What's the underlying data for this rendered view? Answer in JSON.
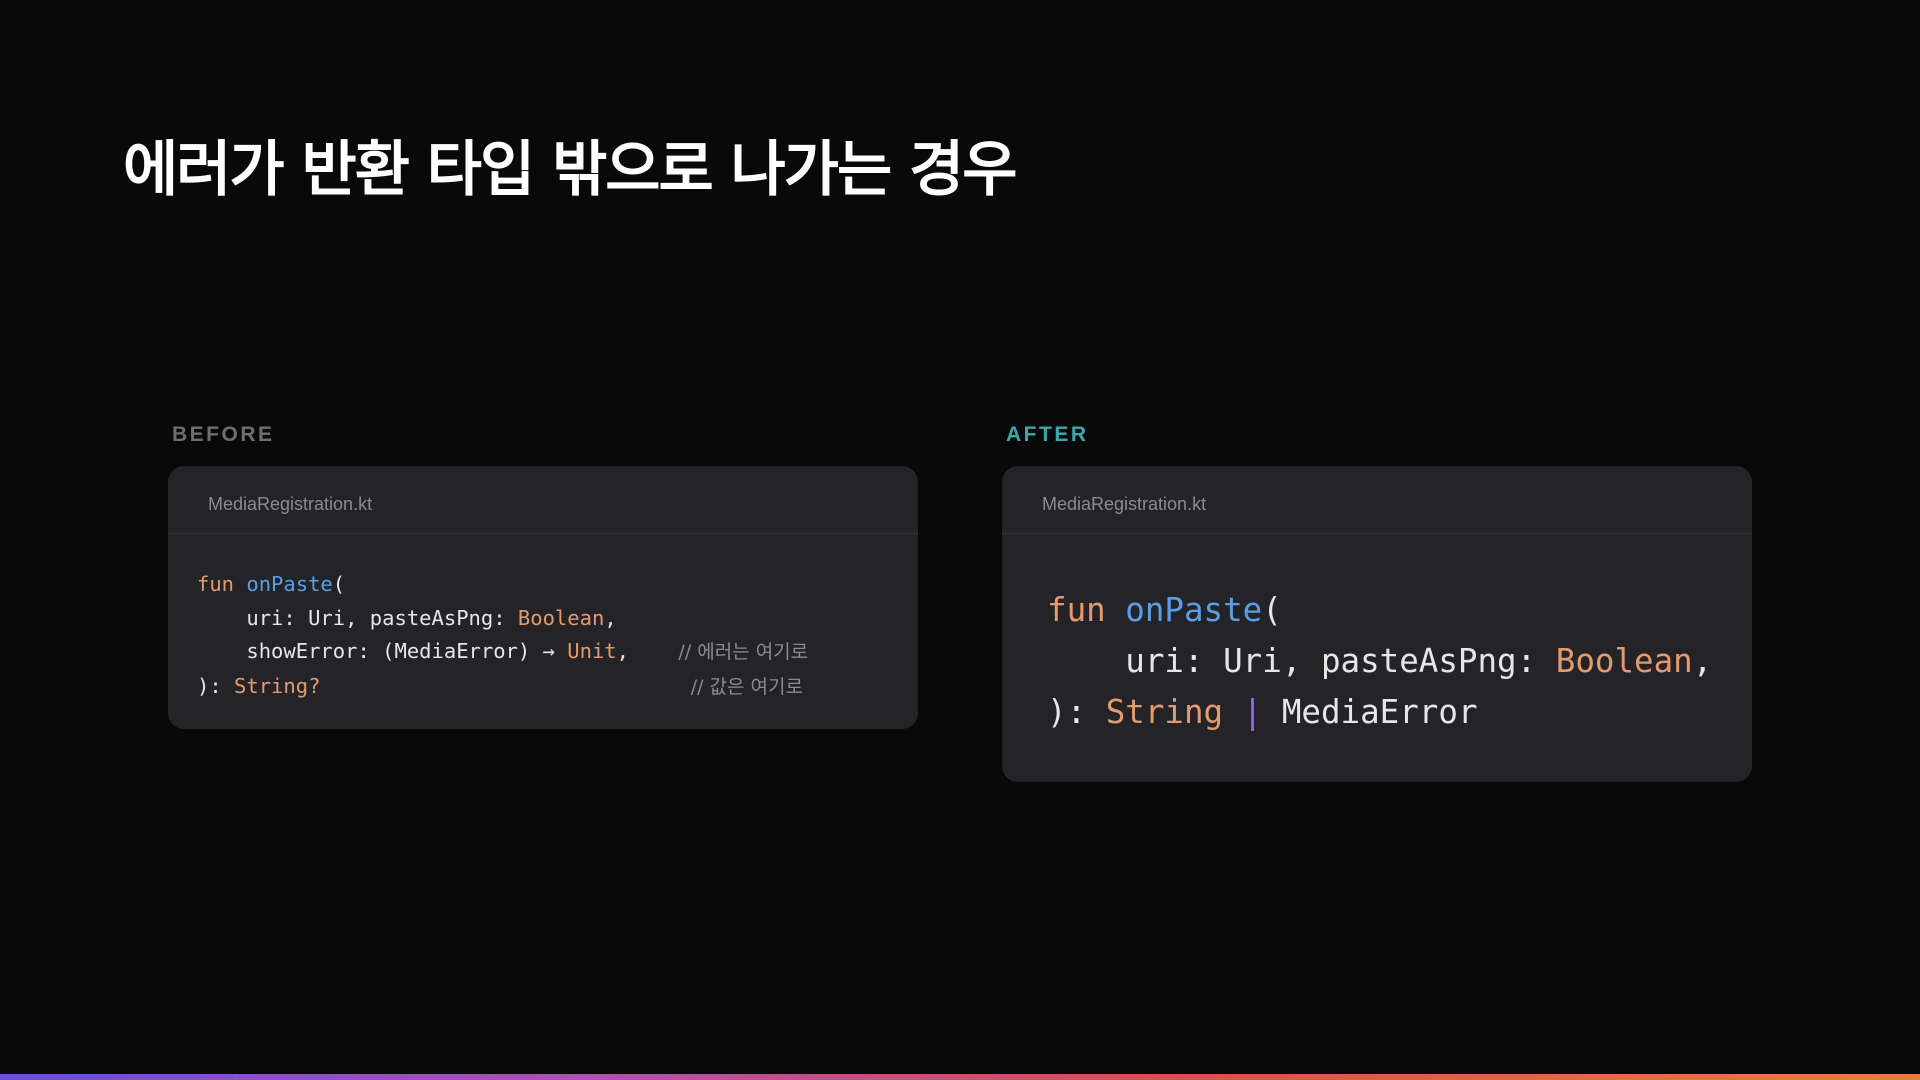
{
  "slide": {
    "title": "에러가 반환 타입 밖으로 나가는 경우"
  },
  "before": {
    "label": "BEFORE",
    "file_name": "MediaRegistration.kt",
    "lines": [
      {
        "kw": "fun",
        "fn": "onPaste",
        "punct": "("
      },
      {
        "indent": "    ",
        "text": "uri: Uri, pasteAsPng: ",
        "type": "Boolean",
        "tail": ","
      },
      {
        "indent": "    ",
        "text": "showError: (MediaError) → ",
        "type": "Unit",
        "tail": ",",
        "comment": "// 에러는 여기로"
      },
      {
        "text": "): ",
        "type": "String?",
        "comment": "// 값은 여기로"
      }
    ]
  },
  "after": {
    "label": "AFTER",
    "file_name": "MediaRegistration.kt",
    "lines": [
      {
        "kw": "fun",
        "fn": "onPaste",
        "punct": "("
      },
      {
        "indent": "    ",
        "text": "uri: Uri, pasteAsPng: ",
        "type": "Boolean",
        "tail": ","
      },
      {
        "text": "): ",
        "type": "String",
        "pipe": "|",
        "text2": "MediaError"
      }
    ]
  },
  "colors": {
    "background": "#09090a",
    "card": "#242428",
    "keyword": "#e49a6c",
    "function": "#5b9ee8",
    "union_pipe": "#9a68de",
    "after_label": "#3aa8ad",
    "before_label": "#6e6e72"
  }
}
